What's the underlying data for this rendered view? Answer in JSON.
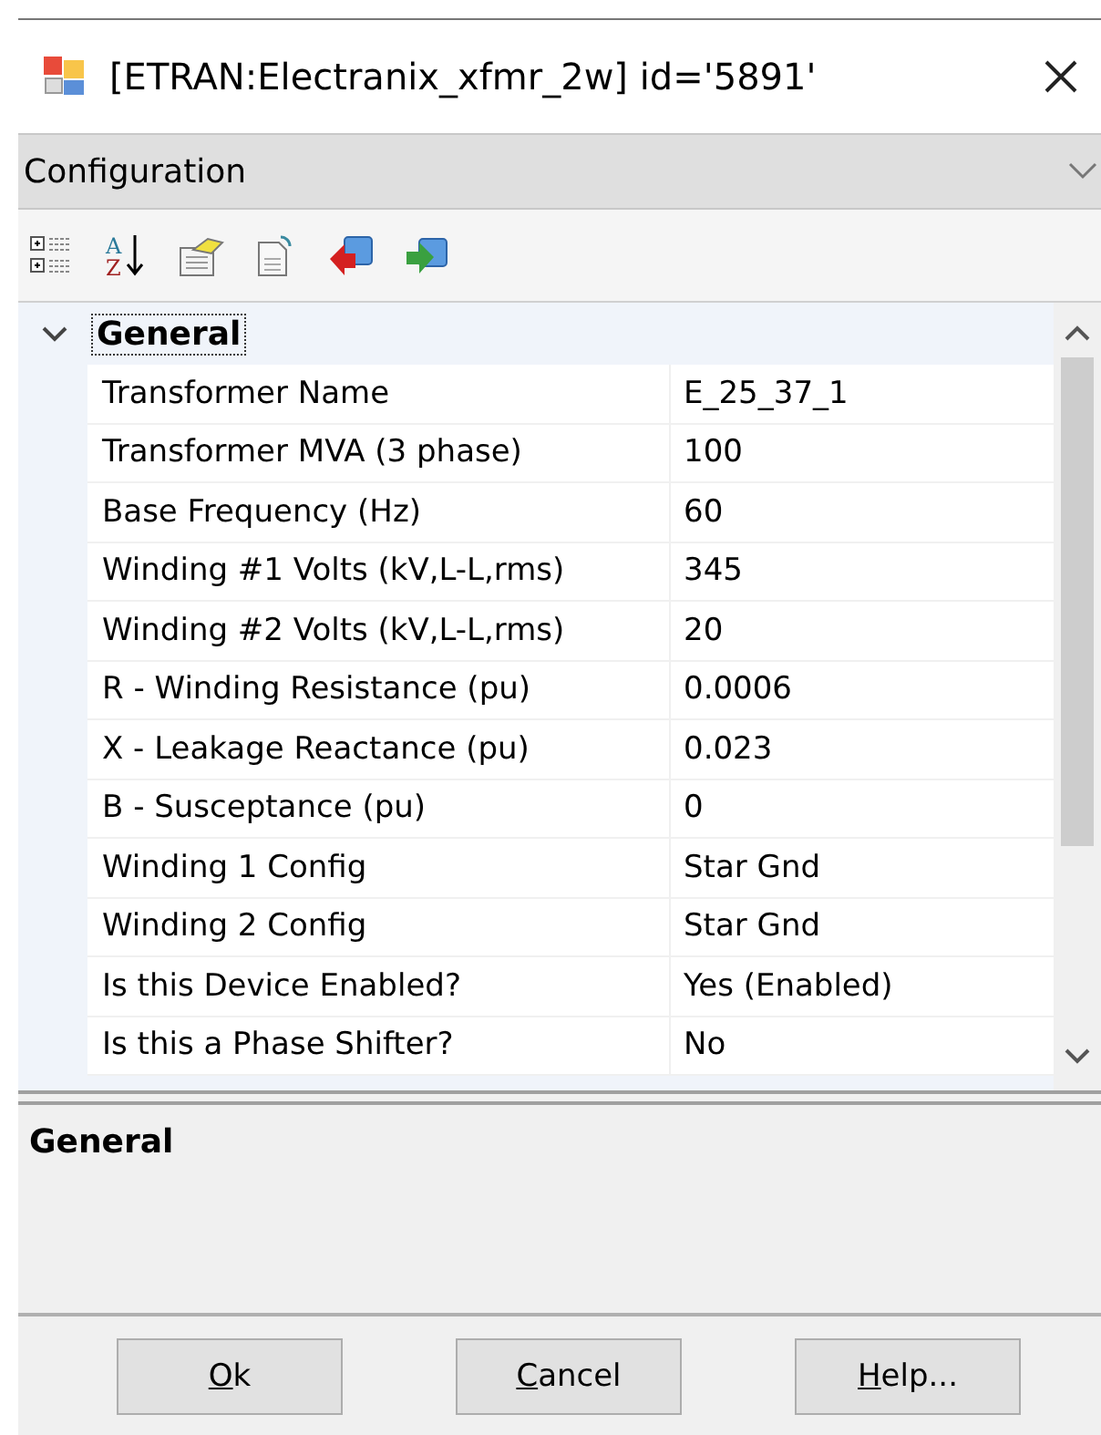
{
  "window": {
    "title": "[ETRAN:Electranix_xfmr_2w] id='5891'"
  },
  "panel": {
    "title": "Configuration"
  },
  "toolbar": {
    "sort_letters": [
      "A",
      "Z"
    ]
  },
  "grid": {
    "category": {
      "label": "General",
      "expanded": true,
      "focused": true
    },
    "rows": [
      {
        "name": "Transformer Name",
        "value": "E_25_37_1"
      },
      {
        "name": "Transformer MVA (3 phase)",
        "value": "100"
      },
      {
        "name": "Base Frequency (Hz)",
        "value": "60"
      },
      {
        "name": "Winding #1 Volts (kV,L-L,rms)",
        "value": "345"
      },
      {
        "name": "Winding #2 Volts (kV,L-L,rms)",
        "value": "20"
      },
      {
        "name": "R - Winding Resistance (pu)",
        "value": "0.0006"
      },
      {
        "name": "X - Leakage Reactance (pu)",
        "value": "0.023"
      },
      {
        "name": "B - Susceptance (pu)",
        "value": "0"
      },
      {
        "name": "Winding 1 Config",
        "value": "Star Gnd"
      },
      {
        "name": "Winding 2 Config",
        "value": "Star Gnd"
      },
      {
        "name": "Is this Device Enabled?",
        "value": "Yes (Enabled)"
      },
      {
        "name": "Is this a Phase Shifter?",
        "value": "No"
      }
    ]
  },
  "description": {
    "title": "General"
  },
  "buttons": [
    {
      "mnemonic": "O",
      "rest": "k"
    },
    {
      "mnemonic": "C",
      "rest": "ancel"
    },
    {
      "mnemonic": "H",
      "rest": "elp..."
    }
  ]
}
